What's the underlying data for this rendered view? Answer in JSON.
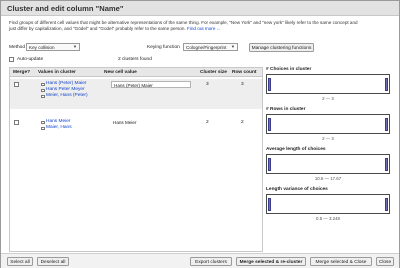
{
  "title": "Cluster and edit column \"Name\"",
  "description": {
    "line1": "Find groups of different cell values that might be alternative representations of the same thing. For example, \"New York\" and \"new york\" likely refer to the same concept and",
    "line2": "just differ by capitalization, and \"Gödel\" and \"Godel\" probably refer to the same person.",
    "link": "Find out more ..."
  },
  "controls": {
    "method_label": "Method",
    "method_value": "Key collision",
    "keying_label": "Keying function",
    "keying_value": "Cologne/Fingerprint",
    "clusters_found": "2 clusters found",
    "manage_button": "Manage clustering functions",
    "auto_update_label": "Auto-update",
    "auto_update_checked": false
  },
  "table": {
    "headers": [
      "Merge?",
      "Values in cluster",
      "New cell value",
      "Cluster size",
      "Row count"
    ],
    "rows": [
      {
        "merge": false,
        "values": [
          "Hans (Peter) Maier",
          "Hans Peter Meyer",
          "Meier, Hans (Peter)"
        ],
        "new_value": "Hans (Peter) Maier",
        "size": "3",
        "rows": "3"
      },
      {
        "merge": false,
        "values": [
          "Hans Meier",
          "Maier, Hans"
        ],
        "new_value": "Hans Meier",
        "size": "2",
        "rows": "2"
      }
    ]
  },
  "facets": [
    {
      "title": "# Choices in cluster",
      "range": "2 — 3"
    },
    {
      "title": "# Rows in cluster",
      "range": "2 — 3"
    },
    {
      "title": "Average length of choices",
      "range": "10.5 — 17.67"
    },
    {
      "title": "Length variance of choices",
      "range": "0.5 — 3.248"
    }
  ],
  "footer": {
    "select_all": "Select all",
    "deselect_all": "Deselect all",
    "export": "Export clusters",
    "merge_recluster": "Merge selected & re-cluster",
    "merge_close": "Merge selected & Close",
    "close": "Close"
  }
}
